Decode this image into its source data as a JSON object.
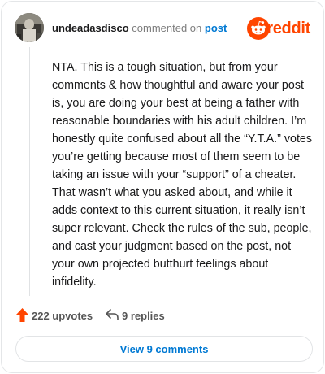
{
  "header": {
    "username": "undeadasdisco",
    "verb": "commented on",
    "post_link": "post",
    "brand": "reddit",
    "avatar_icon": "user-avatar",
    "brand_icon": "reddit-alien-logo-icon",
    "brand_color": "#ff4500"
  },
  "comment": {
    "text": "NTA. This is a tough situation, but from your comments & how thoughtful and aware your post is, you are doing your best at being a father with reasonable boundaries with his adult children. I’m honestly quite confused about all the “Y.T.A.” votes you’re getting because most of them seem to be taking an issue with your “support” of a cheater. That wasn’t what you asked about, and while it adds context to this current situation, it really isn’t super relevant. Check the rules of the sub, people, and cast your judgment based on the post, not your own projected butthurt feelings about infidelity."
  },
  "actions": {
    "upvotes": "222 upvotes",
    "replies": "9 replies",
    "upvote_icon": "upvote-arrow-icon",
    "reply_icon": "reply-arrow-icon",
    "upvote_color": "#ff4500"
  },
  "footer": {
    "view_comments": "View 9 comments"
  }
}
